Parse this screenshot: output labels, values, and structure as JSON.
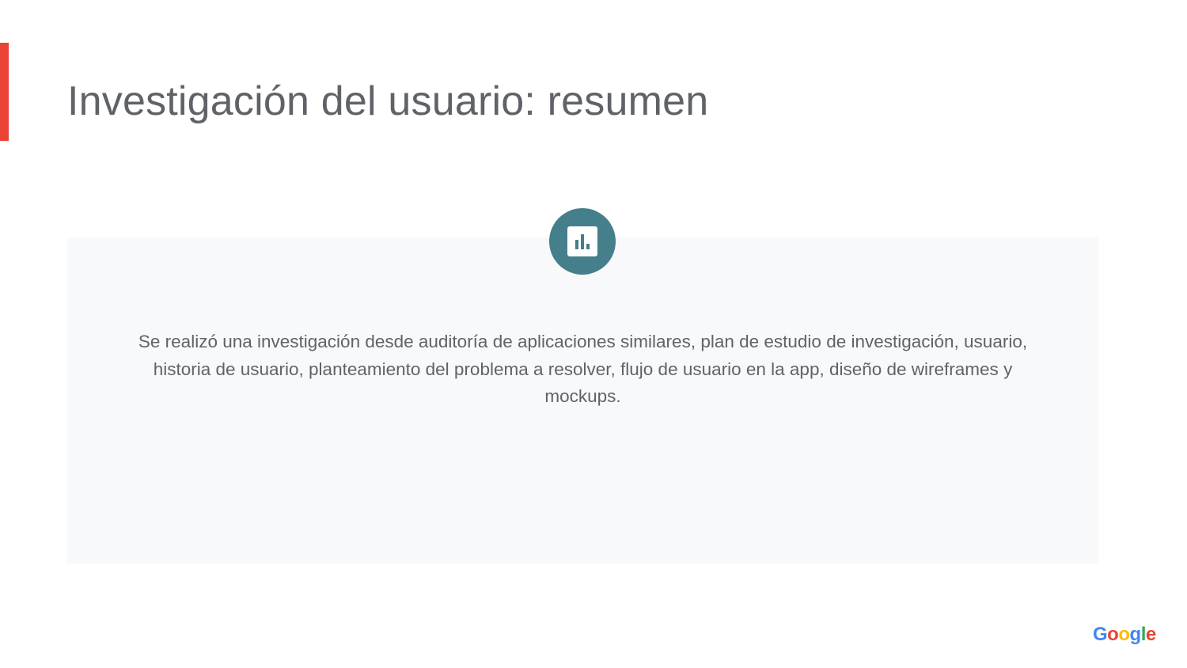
{
  "slide": {
    "title": "Investigación del usuario: resumen",
    "body": "Se realizó una investigación desde auditoría de aplicaciones similares, plan de estudio de investigación, usuario, historia de usuario, planteamiento del problema a resolver, flujo de usuario en la app, diseño de wireframes y mockups.",
    "icon": "bar-chart-icon",
    "logo": "Google"
  },
  "colors": {
    "accent": "#ea4335",
    "icon_circle": "#457f8c",
    "text": "#5f6368",
    "panel": "#f8f9fa"
  }
}
